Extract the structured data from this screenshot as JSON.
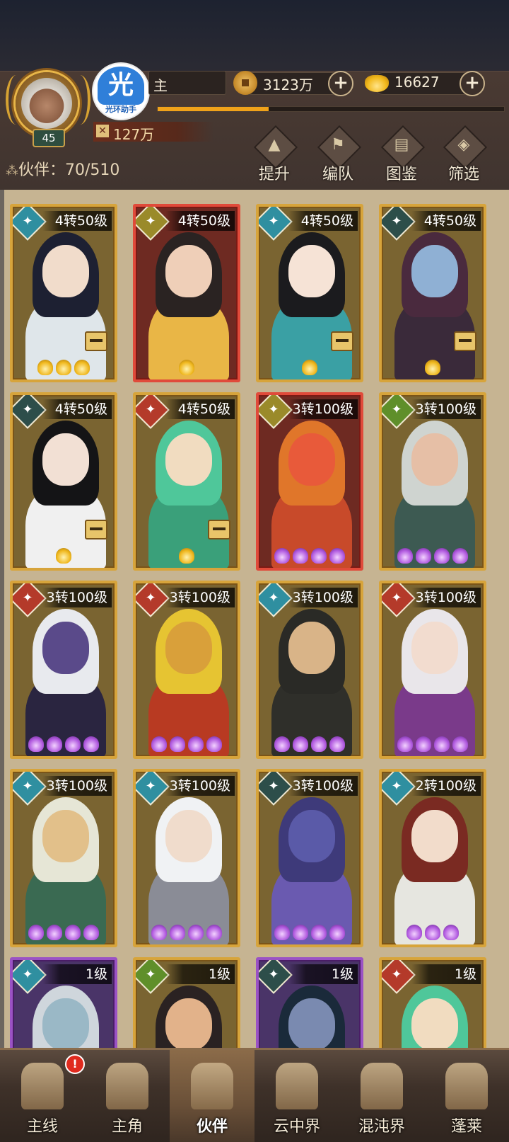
{
  "player": {
    "level": "45",
    "name": "主",
    "logo_text": "光",
    "logo_caption": "光环助手",
    "power": "127万",
    "exp_progress": 0.32
  },
  "currencies": {
    "coins": "3123万",
    "gold": "16627",
    "plus_symbol": "+"
  },
  "partners": {
    "label": "伙伴：70/510"
  },
  "actions": [
    {
      "label": "提升",
      "icon": "upgrade-icon",
      "glyph": "▲"
    },
    {
      "label": "编队",
      "icon": "formation-icon",
      "glyph": "⚑"
    },
    {
      "label": "图鉴",
      "icon": "codex-icon",
      "glyph": "▤"
    },
    {
      "label": "筛选",
      "icon": "filter-icon",
      "glyph": "◈"
    }
  ],
  "cards": [
    {
      "level": "4转50级",
      "frame": "gold",
      "element": "el-water",
      "star_type": "gold",
      "stars": 3,
      "equip": true,
      "hair": "#1d2032",
      "skin": "#f1dccb",
      "body": "#dfe6ea"
    },
    {
      "level": "4转50级",
      "frame": "red",
      "element": "el-earth",
      "star_type": "gold",
      "stars": 1,
      "equip": false,
      "hair": "#2a2322",
      "skin": "#efcfb8",
      "body": "#e9b646"
    },
    {
      "level": "4转50级",
      "frame": "gold",
      "element": "el-water",
      "star_type": "gold",
      "stars": 1,
      "equip": true,
      "hair": "#1b1b1e",
      "skin": "#f6e3d6",
      "body": "#3aa0a4"
    },
    {
      "level": "4转50级",
      "frame": "gold",
      "element": "el-dark",
      "star_type": "gold",
      "stars": 1,
      "equip": true,
      "hair": "#4a2a3e",
      "skin": "#8fb0d4",
      "body": "#3a2a3a"
    },
    {
      "level": "4转50级",
      "frame": "gold",
      "element": "el-dark",
      "star_type": "gold",
      "stars": 1,
      "equip": true,
      "hair": "#141416",
      "skin": "#f2e0d4",
      "body": "#f0f0f0"
    },
    {
      "level": "4转50级",
      "frame": "gold",
      "element": "el-fire",
      "star_type": "gold",
      "stars": 1,
      "equip": true,
      "hair": "#4fc79a",
      "skin": "#f1dcc0",
      "body": "#3aa07a"
    },
    {
      "level": "3转100级",
      "frame": "red",
      "element": "el-earth",
      "star_type": "purple",
      "stars": 4,
      "equip": false,
      "hair": "#e0762a",
      "skin": "#e85a3a",
      "body": "#c84a2a"
    },
    {
      "level": "3转100级",
      "frame": "gold",
      "element": "el-wood",
      "star_type": "purple",
      "stars": 4,
      "equip": false,
      "hair": "#cfd4d0",
      "skin": "#e6bfa6",
      "body": "#3d5a52"
    },
    {
      "level": "3转100级",
      "frame": "gold",
      "element": "el-fire",
      "star_type": "purple",
      "stars": 4,
      "equip": false,
      "hair": "#e8eaee",
      "skin": "#5a4a8a",
      "body": "#2a2540"
    },
    {
      "level": "3转100级",
      "frame": "gold",
      "element": "el-fire",
      "star_type": "purple",
      "stars": 4,
      "equip": false,
      "hair": "#e6c432",
      "skin": "#d9a03a",
      "body": "#b83a22"
    },
    {
      "level": "3转100级",
      "frame": "gold",
      "element": "el-water",
      "star_type": "purple",
      "stars": 4,
      "equip": false,
      "hair": "#2a2a26",
      "skin": "#d9b488",
      "body": "#2f2f2a"
    },
    {
      "level": "3转100级",
      "frame": "gold",
      "element": "el-fire",
      "star_type": "purple",
      "stars": 4,
      "equip": false,
      "hair": "#e9e6ea",
      "skin": "#f2dccf",
      "body": "#7a3a8a"
    },
    {
      "level": "3转100级",
      "frame": "gold",
      "element": "el-water",
      "star_type": "purple",
      "stars": 4,
      "equip": false,
      "hair": "#e6e6d6",
      "skin": "#e2c08a",
      "body": "#3a6a52"
    },
    {
      "level": "3转100级",
      "frame": "gold",
      "element": "el-water",
      "star_type": "purple",
      "stars": 4,
      "equip": false,
      "hair": "#f0f2f4",
      "skin": "#f0dccc",
      "body": "#8a8c96"
    },
    {
      "level": "3转100级",
      "frame": "gold",
      "element": "el-dark",
      "star_type": "purple",
      "stars": 4,
      "equip": false,
      "hair": "#3e3a7a",
      "skin": "#5a5aa8",
      "body": "#6a5ab0"
    },
    {
      "level": "2转100级",
      "frame": "gold",
      "element": "el-water",
      "star_type": "purple",
      "stars": 3,
      "equip": false,
      "hair": "#7a2a22",
      "skin": "#f2dccb",
      "body": "#e6e6e0"
    },
    {
      "level": "1级",
      "frame": "purple",
      "element": "el-water",
      "star_type": "purple",
      "stars": 0,
      "equip": false,
      "hair": "#cfd6dc",
      "skin": "#9ab8c6",
      "body": "#3a2a4a"
    },
    {
      "level": "1级",
      "frame": "gold",
      "element": "el-wood",
      "star_type": "purple",
      "stars": 0,
      "equip": false,
      "hair": "#2a2222",
      "skin": "#e2b28a",
      "body": "#3a2a22"
    },
    {
      "level": "1级",
      "frame": "purple",
      "element": "el-dark",
      "star_type": "purple",
      "stars": 0,
      "equip": false,
      "hair": "#1a2a3a",
      "skin": "#7a8ab0",
      "body": "#2a2a40"
    },
    {
      "level": "1级",
      "frame": "gold",
      "element": "el-fire",
      "star_type": "purple",
      "stars": 0,
      "equip": false,
      "hair": "#4fc79a",
      "skin": "#f1dcc0",
      "body": "#3aa07a"
    }
  ],
  "nav": [
    {
      "label": "主线",
      "icon": "main-quest-icon",
      "active": false,
      "badge": "!"
    },
    {
      "label": "主角",
      "icon": "hero-icon",
      "active": false,
      "badge": ""
    },
    {
      "label": "伙伴",
      "icon": "partners-icon",
      "active": true,
      "badge": ""
    },
    {
      "label": "云中界",
      "icon": "cloud-realm-icon",
      "active": false,
      "badge": ""
    },
    {
      "label": "混沌界",
      "icon": "chaos-realm-icon",
      "active": false,
      "badge": ""
    },
    {
      "label": "蓬莱",
      "icon": "penglai-icon",
      "active": false,
      "badge": ""
    }
  ]
}
